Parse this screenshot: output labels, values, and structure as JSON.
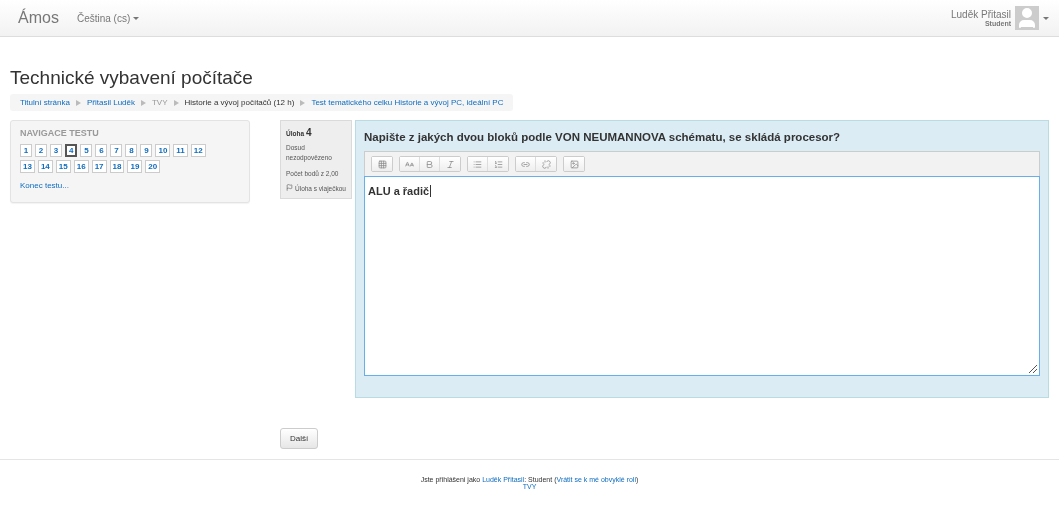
{
  "navbar": {
    "brand": "Ámos",
    "language": "Čeština (cs)",
    "user_name": "Luděk Přitasil",
    "user_role": "Student"
  },
  "page_title": "Technické vybavení počítače",
  "breadcrumb": [
    {
      "label": "Titulní stránka",
      "kind": "link"
    },
    {
      "label": "Přitasil Luděk",
      "kind": "link"
    },
    {
      "label": "TVY",
      "kind": "muted"
    },
    {
      "label": "Historie a vývoj počítačů (12 h)",
      "kind": "plain"
    },
    {
      "label": "Test tematického celku Historie a vývoj PC, ideální PC",
      "kind": "link"
    }
  ],
  "quiz_navigation": {
    "title": "NAVIGACE TESTU",
    "questions": [
      {
        "label": "1",
        "selected": false
      },
      {
        "label": "2",
        "selected": false
      },
      {
        "label": "3",
        "selected": false
      },
      {
        "label": "4",
        "selected": true
      },
      {
        "label": "5",
        "selected": false
      },
      {
        "label": "6",
        "selected": false
      },
      {
        "label": "7",
        "selected": false
      },
      {
        "label": "8",
        "selected": false
      },
      {
        "label": "9",
        "selected": false
      },
      {
        "label": "10",
        "selected": false
      },
      {
        "label": "11",
        "selected": false
      },
      {
        "label": "12",
        "selected": false
      },
      {
        "label": "13",
        "selected": false
      },
      {
        "label": "14",
        "selected": false
      },
      {
        "label": "15",
        "selected": false
      },
      {
        "label": "16",
        "selected": false
      },
      {
        "label": "17",
        "selected": false
      },
      {
        "label": "18",
        "selected": false
      },
      {
        "label": "19",
        "selected": false
      },
      {
        "label": "20",
        "selected": false
      }
    ],
    "finish_link": "Konec testu..."
  },
  "question_info": {
    "label": "Úloha",
    "number": "4",
    "status": "Dosud nezodpovězeno",
    "points": "Počet bodů z 2,00",
    "flag": "Úloha s vlaječkou"
  },
  "question": {
    "text": "Napište z jakých dvou bloků podle VON NEUMANNOVA schématu, se skládá procesor?",
    "answer": "ALU a řadič"
  },
  "next_button": "Další",
  "footer": {
    "prefix": "Jste přihlášeni jako",
    "user_link": "Luděk Přitasil",
    "middle": ": Student (",
    "role_link": "Vrátit se k mé obvyklé roli",
    "suffix": ")",
    "course_link": "TVY"
  }
}
